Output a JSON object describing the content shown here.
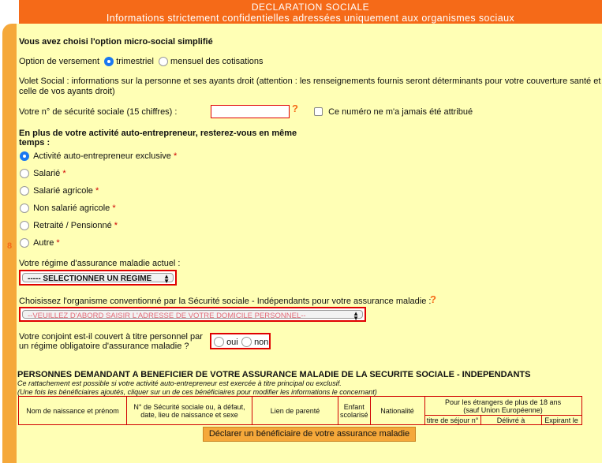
{
  "header": {
    "title": "DECLARATION SOCIALE",
    "subtitle": "Informations strictement confidentielles adressées uniquement aux organismes sociaux"
  },
  "side": {
    "step_number": "8"
  },
  "option": {
    "heading": "Vous avez choisi l'option micro-social simplifié",
    "versement_label": "Option de versement",
    "trimestriel": "trimestriel",
    "mensuel": "mensuel des cotisations"
  },
  "volet": {
    "line1": "Volet Social : informations sur la personne et ses ayants droit (attention : les renseignements fournis seront déterminants pour votre couverture santé et",
    "line2": "celle de vos ayants droit)"
  },
  "secu": {
    "label": "Votre n° de sécurité sociale (15 chiffres) :",
    "value": "",
    "help": "?",
    "never_label": "Ce numéro ne m'a jamais été attribué"
  },
  "activite": {
    "heading_line1": "En plus de votre activité auto-entrepreneur, resterez-vous en même",
    "heading_line2": "temps :",
    "options": [
      {
        "label": "Activité auto-entrepreneur exclusive",
        "req": "*"
      },
      {
        "label": "Salarié",
        "req": "*"
      },
      {
        "label": "Salarié agricole",
        "req": "*"
      },
      {
        "label": "Non salarié agricole",
        "req": "*"
      },
      {
        "label": "Retraité / Pensionné",
        "req": "*"
      },
      {
        "label": "Autre",
        "req": "*"
      }
    ]
  },
  "regime": {
    "label": "Votre régime d'assurance maladie actuel :",
    "selected": "----- SELECTIONNER UN REGIME"
  },
  "organisme": {
    "label": "Choisissez l'organisme conventionné par la Sécurité sociale - Indépendants pour votre assurance maladie :",
    "help": "?",
    "selected": "--VEUILLEZ D'ABORD SAISIR L'ADRESSE DE VOTRE DOMICILE PERSONNEL--"
  },
  "conjoint": {
    "line1": "Votre conjoint est-il couvert à titre personnel par",
    "line2": "un régime obligatoire d'assurance maladie ?",
    "oui": "oui",
    "non": "non"
  },
  "beneficiaires": {
    "title": "PERSONNES DEMANDANT A BENEFICIER DE VOTRE ASSURANCE MALADIE DE LA SECURITE SOCIALE - INDEPENDANTS",
    "note1": "Ce rattachement est possible si votre activité auto-entrepreneur est exercée à titre principal ou exclusif.",
    "note2": "(Une fois les bénéficiaires ajoutés, cliquer sur un de ces bénéficiaires pour modifier les informations le concernant)",
    "col_nom": "Nom de naissance et prénom",
    "col_secu_1": "N° de Sécurité sociale ou, à défaut,",
    "col_secu_2": "date, lieu de naissance et sexe",
    "col_lien": "Lien de parenté",
    "col_enfant_1": "Enfant",
    "col_enfant_2": "scolarisé",
    "col_nat": "Nationalité",
    "col_etr_1": "Pour les étrangers de plus de 18 ans",
    "col_etr_2": "(sauf Union Européenne)",
    "sub_titre": "titre de séjour n°",
    "sub_delivre": "Délivré à",
    "sub_expirant": "Expirant le",
    "button": "Déclarer un  bénéficiaire de votre assurance maladie"
  }
}
